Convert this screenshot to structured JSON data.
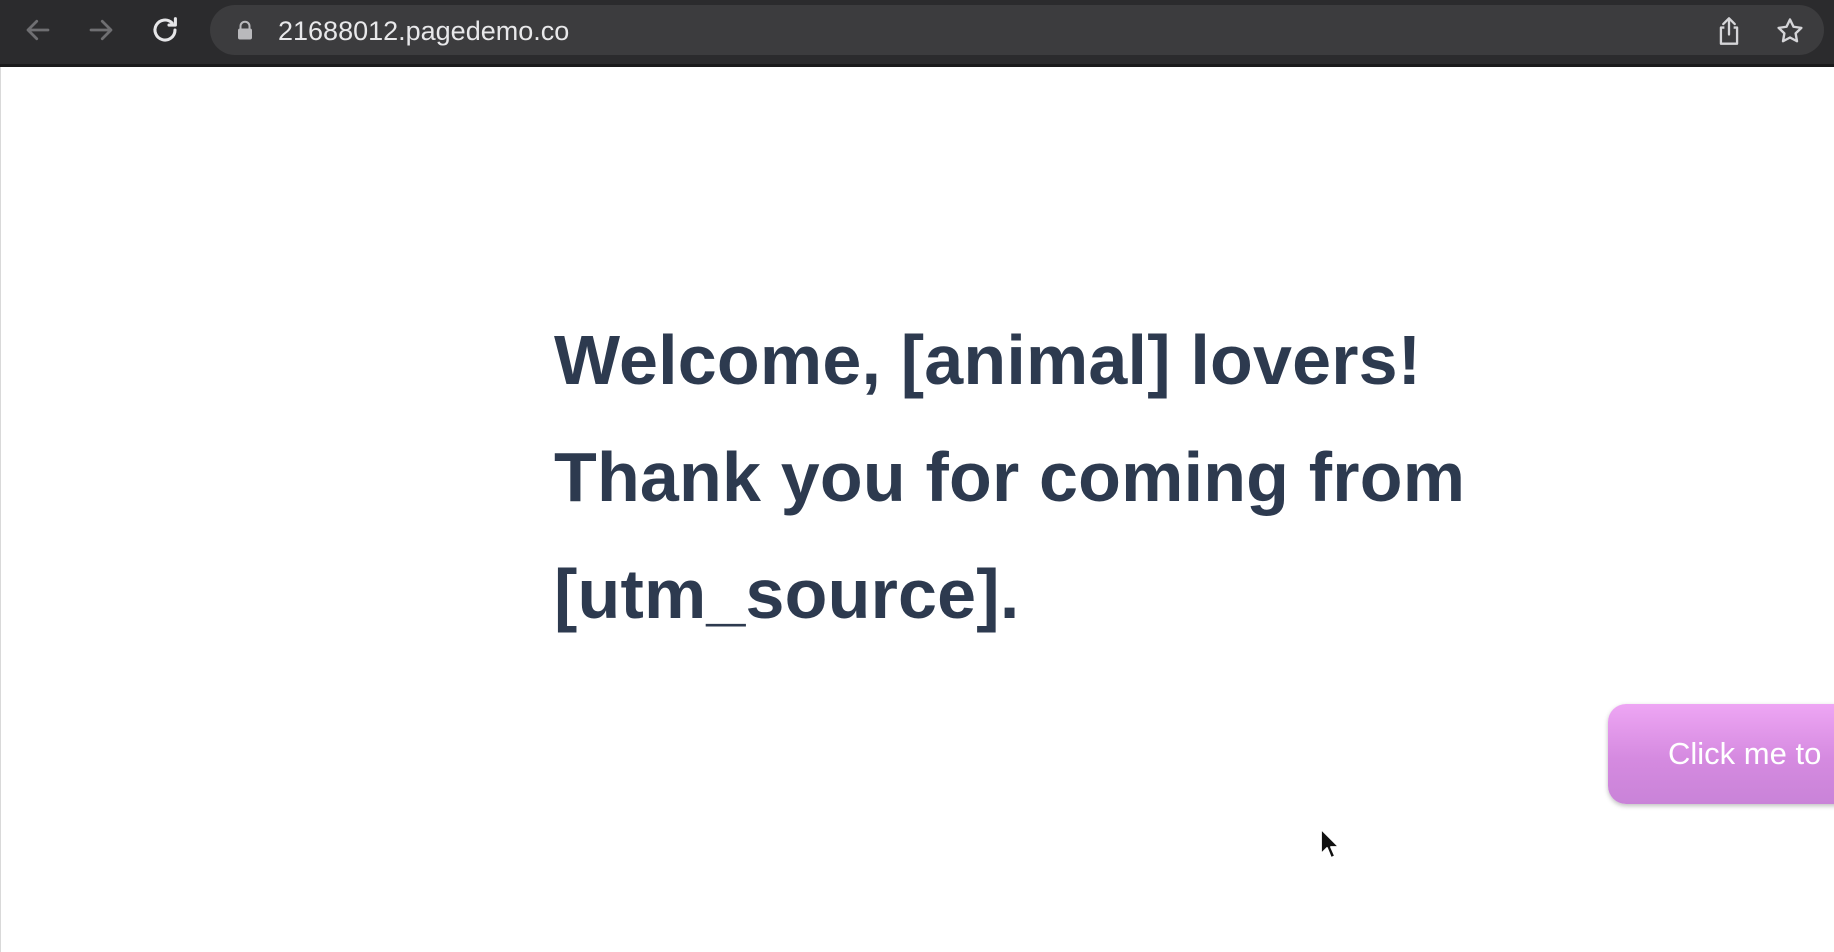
{
  "browser": {
    "url": "21688012.pagedemo.co",
    "icons": {
      "back": "arrow-left-icon",
      "forward": "arrow-right-icon",
      "reload": "reload-icon",
      "lock": "lock-icon",
      "share": "share-icon",
      "bookmark": "star-icon"
    }
  },
  "page": {
    "heading_lines": [
      "Welcome, [animal] lovers!",
      "Thank you for coming from",
      "[utm_source]."
    ],
    "cta_label": "Click me to"
  },
  "colors": {
    "toolbar": "#2b2b2d",
    "address_bar": "#3c3c3e",
    "heading": "#2d3a4f",
    "cta_top": "#eea6f4",
    "cta_bottom": "#c983d8"
  }
}
